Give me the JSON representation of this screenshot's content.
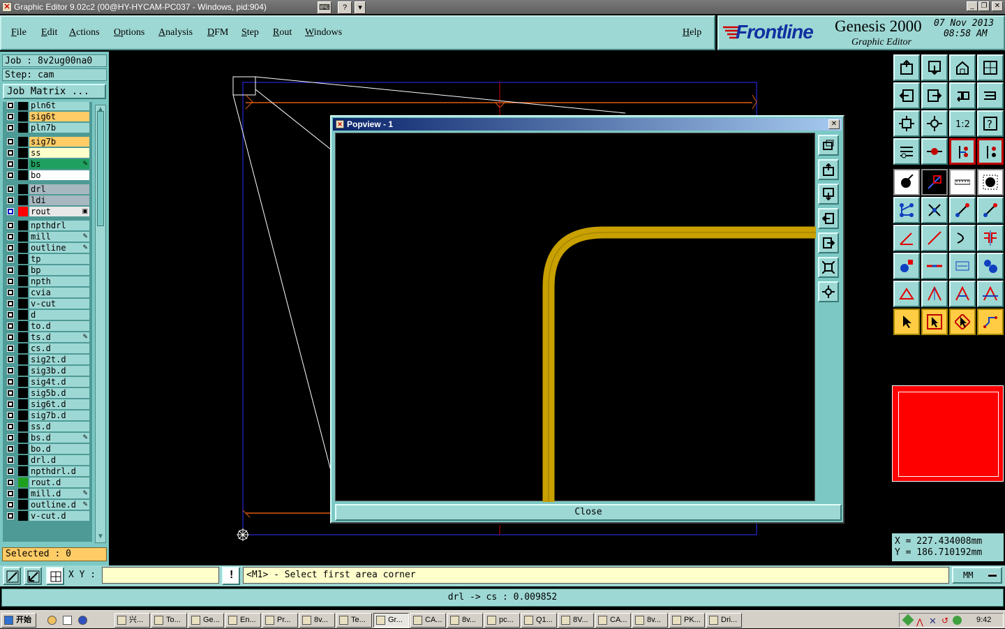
{
  "window": {
    "title": "Graphic Editor 9.02c2 (00@HY-HYCAM-PC037 - Windows, pid:904)"
  },
  "menu": [
    "File",
    "Edit",
    "Actions",
    "Options",
    "Analysis",
    "DFM",
    "Step",
    "Rout",
    "Windows"
  ],
  "help_label": "Help",
  "brand": {
    "logo": "Frontline",
    "product": "Genesis 2000",
    "subtitle": "Graphic Editor",
    "date": "07 Nov 2013",
    "time": "08:58 AM"
  },
  "job": {
    "job_label": "Job : 8v2ug00na0",
    "step_label": "Step: cam",
    "matrix_button": "Job Matrix ..."
  },
  "layers": [
    {
      "name": "pln6t",
      "color": "#9ed8d4",
      "swatch": "#000000",
      "icon": ""
    },
    {
      "name": "sig6t",
      "color": "#ffcc66",
      "swatch": "#000000",
      "icon": ""
    },
    {
      "name": "pln7b",
      "color": "#9ed8d4",
      "swatch": "#000000",
      "icon": ""
    },
    {
      "name": "sig7b",
      "color": "#ffcc66",
      "swatch": "#000000",
      "icon": ""
    },
    {
      "name": "ss",
      "color": "#ffffcc",
      "swatch": "#000000",
      "icon": ""
    },
    {
      "name": "bs",
      "color": "#20a060",
      "swatch": "#000000",
      "icon": "✎"
    },
    {
      "name": "bo",
      "color": "#ffffff",
      "swatch": "#000000",
      "icon": ""
    },
    {
      "name": "drl",
      "color": "#a8b8c0",
      "swatch": "#000000",
      "icon": ""
    },
    {
      "name": "ldi",
      "color": "#a8b8c0",
      "swatch": "#000000",
      "icon": ""
    },
    {
      "name": "rout",
      "color": "#e8e8e8",
      "swatch": "#ff0000",
      "icon": "▣"
    },
    {
      "name": "npthdrl",
      "color": "#9ed8d4",
      "swatch": "#000000",
      "icon": ""
    },
    {
      "name": "mill",
      "color": "#9ed8d4",
      "swatch": "#000000",
      "icon": "✎"
    },
    {
      "name": "outline",
      "color": "#9ed8d4",
      "swatch": "#000000",
      "icon": "✎"
    },
    {
      "name": "tp",
      "color": "#9ed8d4",
      "swatch": "#000000",
      "icon": ""
    },
    {
      "name": "bp",
      "color": "#9ed8d4",
      "swatch": "#000000",
      "icon": ""
    },
    {
      "name": "npth",
      "color": "#9ed8d4",
      "swatch": "#000000",
      "icon": ""
    },
    {
      "name": "cvia",
      "color": "#9ed8d4",
      "swatch": "#000000",
      "icon": ""
    },
    {
      "name": "v-cut",
      "color": "#9ed8d4",
      "swatch": "#000000",
      "icon": ""
    },
    {
      "name": "d",
      "color": "#9ed8d4",
      "swatch": "#000000",
      "icon": ""
    },
    {
      "name": "to.d",
      "color": "#9ed8d4",
      "swatch": "#000000",
      "icon": ""
    },
    {
      "name": "ts.d",
      "color": "#9ed8d4",
      "swatch": "#000000",
      "icon": "✎"
    },
    {
      "name": "cs.d",
      "color": "#9ed8d4",
      "swatch": "#000000",
      "icon": ""
    },
    {
      "name": "sig2t.d",
      "color": "#9ed8d4",
      "swatch": "#000000",
      "icon": ""
    },
    {
      "name": "sig3b.d",
      "color": "#9ed8d4",
      "swatch": "#000000",
      "icon": ""
    },
    {
      "name": "sig4t.d",
      "color": "#9ed8d4",
      "swatch": "#000000",
      "icon": ""
    },
    {
      "name": "sig5b.d",
      "color": "#9ed8d4",
      "swatch": "#000000",
      "icon": ""
    },
    {
      "name": "sig6t.d",
      "color": "#9ed8d4",
      "swatch": "#000000",
      "icon": ""
    },
    {
      "name": "sig7b.d",
      "color": "#9ed8d4",
      "swatch": "#000000",
      "icon": ""
    },
    {
      "name": "ss.d",
      "color": "#9ed8d4",
      "swatch": "#000000",
      "icon": ""
    },
    {
      "name": "bs.d",
      "color": "#9ed8d4",
      "swatch": "#000000",
      "icon": "✎"
    },
    {
      "name": "bo.d",
      "color": "#9ed8d4",
      "swatch": "#000000",
      "icon": ""
    },
    {
      "name": "drl.d",
      "color": "#9ed8d4",
      "swatch": "#000000",
      "icon": ""
    },
    {
      "name": "npthdrl.d",
      "color": "#9ed8d4",
      "swatch": "#000000",
      "icon": ""
    },
    {
      "name": "rout.d",
      "color": "#9ed8d4",
      "swatch": "#20a020",
      "icon": ""
    },
    {
      "name": "mill.d",
      "color": "#9ed8d4",
      "swatch": "#000000",
      "icon": "✎"
    },
    {
      "name": "outline.d",
      "color": "#9ed8d4",
      "swatch": "#000000",
      "icon": "✎"
    },
    {
      "name": "v-cut.d",
      "color": "#9ed8d4",
      "swatch": "#000000",
      "icon": ""
    }
  ],
  "selected_label": "Selected : 0",
  "popview": {
    "title": "Popview - 1",
    "close_label": "Close"
  },
  "coords": {
    "x": "X = 227.434008mm",
    "y": "Y = 186.710192mm"
  },
  "command": {
    "xy_label": "X Y :",
    "xy_value": "",
    "prompt": "<M1> - Select first area corner",
    "units": "MM"
  },
  "status_text": "drl -> cs : 0.009852",
  "taskbar": {
    "start": "开始",
    "tasks": [
      "兴...",
      "To...",
      "Ge...",
      "En...",
      "Pr...",
      "8v...",
      "Te...",
      "Gr...",
      "CA...",
      "8v...",
      "pc...",
      "Q1...",
      "8V...",
      "CA...",
      "8v...",
      "PK...",
      "Dri..."
    ],
    "clock": "9:42"
  },
  "colors": {
    "panel": "#9ed8d4",
    "trace": "#c8a000",
    "rout": "#ff0000",
    "outline": "#4040ff"
  }
}
